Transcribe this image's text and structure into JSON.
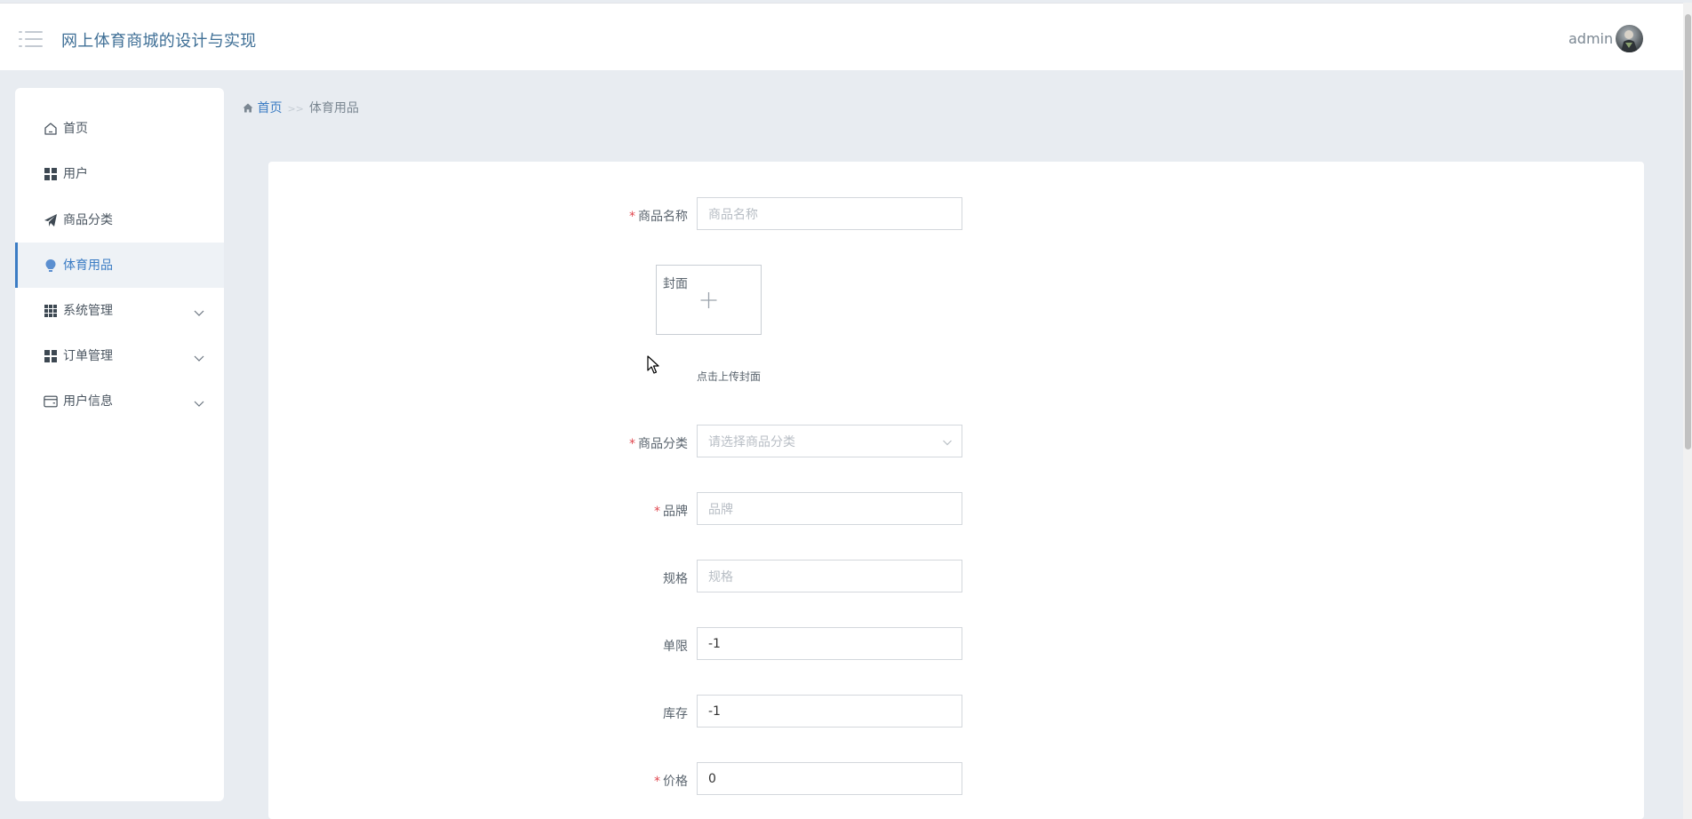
{
  "header": {
    "app_title": "网上体育商城的设计与实现",
    "user_name": "admin"
  },
  "sidebar": {
    "items": [
      {
        "label": "首页",
        "icon": "home-icon",
        "active": false,
        "expandable": false
      },
      {
        "label": "用户",
        "icon": "grid-icon",
        "active": false,
        "expandable": false
      },
      {
        "label": "商品分类",
        "icon": "paper-plane-icon",
        "active": false,
        "expandable": false
      },
      {
        "label": "体育用品",
        "icon": "bulb-icon",
        "active": true,
        "expandable": false
      },
      {
        "label": "系统管理",
        "icon": "apps-icon",
        "active": false,
        "expandable": true
      },
      {
        "label": "订单管理",
        "icon": "grid-icon",
        "active": false,
        "expandable": true
      },
      {
        "label": "用户信息",
        "icon": "wallet-icon",
        "active": false,
        "expandable": true
      }
    ]
  },
  "breadcrumb": {
    "home": "首页",
    "separator": ">>",
    "current": "体育用品"
  },
  "form": {
    "name": {
      "label": "商品名称",
      "required": true,
      "value": "",
      "placeholder": "商品名称"
    },
    "cover": {
      "label": "封面",
      "hint": "点击上传封面"
    },
    "category": {
      "label": "商品分类",
      "required": true,
      "value": "",
      "placeholder": "请选择商品分类"
    },
    "brand": {
      "label": "品牌",
      "required": true,
      "value": "",
      "placeholder": "品牌"
    },
    "spec": {
      "label": "规格",
      "required": false,
      "value": "",
      "placeholder": "规格"
    },
    "limit": {
      "label": "单限",
      "required": false,
      "value": "-1"
    },
    "stock": {
      "label": "库存",
      "required": false,
      "value": "-1"
    },
    "price": {
      "label": "价格",
      "required": true,
      "value": "0"
    }
  },
  "colors": {
    "accent": "#3b7cc4",
    "required": "#e0474f",
    "page_bg": "#e8ecf1"
  }
}
